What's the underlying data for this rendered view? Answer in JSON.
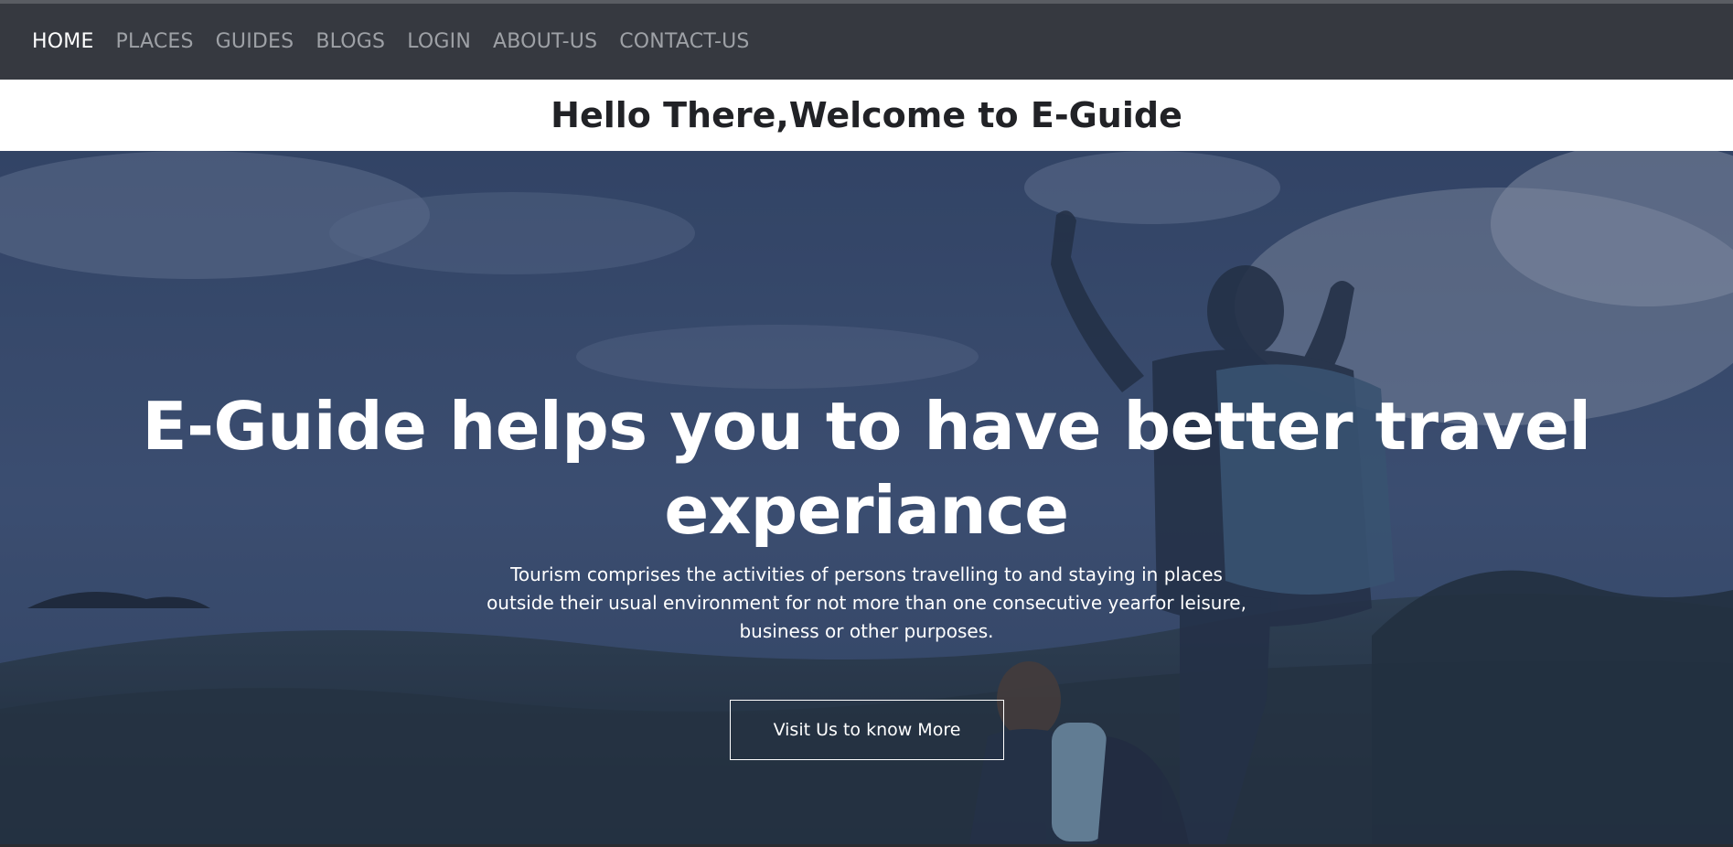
{
  "nav": {
    "items": [
      {
        "label": "HOME",
        "active": true
      },
      {
        "label": "PLACES",
        "active": false
      },
      {
        "label": "GUIDES",
        "active": false
      },
      {
        "label": "BLOGS",
        "active": false
      },
      {
        "label": "LOGIN",
        "active": false
      },
      {
        "label": "ABOUT-US",
        "active": false
      },
      {
        "label": "CONTACT-US",
        "active": false
      }
    ]
  },
  "welcome": {
    "title": "Hello There,Welcome to E-Guide"
  },
  "hero": {
    "heading": "E-Guide helps you to have better travel experiance",
    "description": "Tourism comprises the activities of persons travelling to and staying in places outside their usual environment for not more than one consecutive yearfor leisure, business or other purposes.",
    "button_label": "Visit Us to know More"
  },
  "colors": {
    "navbar_bg": "#363940",
    "nav_inactive": "#9ea1a6",
    "nav_active": "#ffffff",
    "welcome_text": "#212226"
  }
}
